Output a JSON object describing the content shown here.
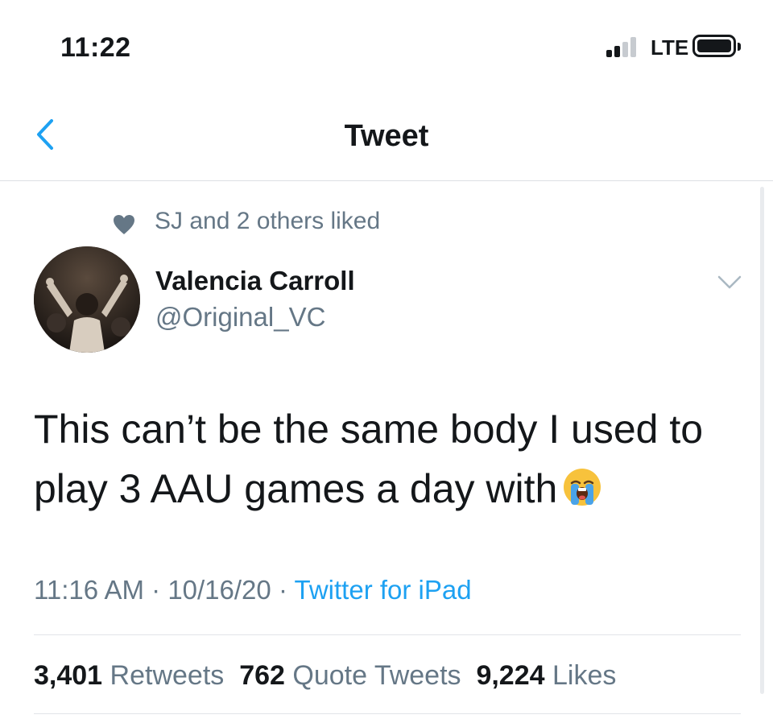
{
  "status_bar": {
    "time": "11:22",
    "network": "LTE",
    "signal_bars": 2
  },
  "nav": {
    "title": "Tweet"
  },
  "social_context": {
    "text": "SJ and 2 others liked"
  },
  "author": {
    "name": "Valencia Carroll",
    "handle": "@Original_VC"
  },
  "tweet": {
    "text": "This can’t be the same body I used to play 3 AAU games a day with",
    "emoji": "crying-face-emoji"
  },
  "meta": {
    "time": "11:16 AM",
    "date": "10/16/20",
    "separator": " · ",
    "source": "Twitter for iPad"
  },
  "stats": {
    "retweets": {
      "count": "3,401",
      "label": "Retweets"
    },
    "quotes": {
      "count": "762",
      "label": "Quote Tweets"
    },
    "likes": {
      "count": "9,224",
      "label": "Likes"
    }
  },
  "colors": {
    "accent": "#1da1f2",
    "secondary_text": "#657786",
    "primary_text": "#14171a"
  }
}
